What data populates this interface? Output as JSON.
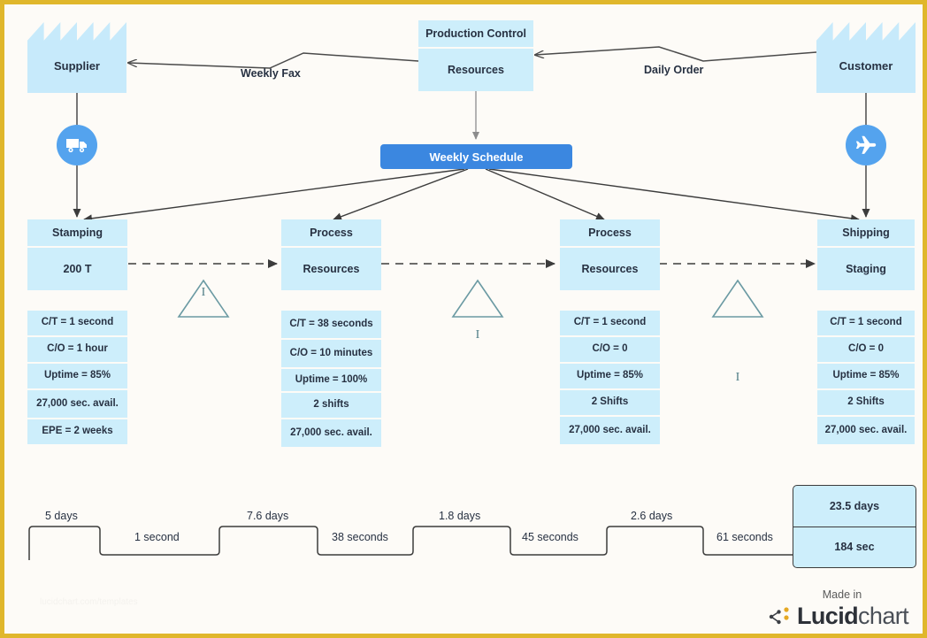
{
  "page": {
    "border_color": "#e0b72c",
    "background": "#fdfbf7",
    "watermark": "lucidchart.com/templates"
  },
  "colors": {
    "box_fill": "#cdeefb",
    "schedule_fill": "#3b87e0",
    "icon_circle": "#54a3ee",
    "triangle_stroke": "#4e7d86",
    "text": "#273142"
  },
  "entities": {
    "supplier": {
      "label": "Supplier",
      "icon": "factory-icon"
    },
    "customer": {
      "label": "Customer",
      "icon": "factory-icon"
    },
    "production_control": {
      "title": "Production Control",
      "body": "Resources"
    },
    "schedule": {
      "label": "Weekly Schedule"
    }
  },
  "transport": {
    "inbound": {
      "icon": "truck-icon"
    },
    "outbound": {
      "icon": "airplane-icon"
    }
  },
  "information_flows": [
    {
      "label": "Weekly Fax",
      "from": "production-control",
      "to": "supplier",
      "type": "electronic"
    },
    {
      "label": "Daily Order",
      "from": "customer",
      "to": "production-control",
      "type": "electronic"
    }
  ],
  "processes": [
    {
      "title": "Stamping",
      "body": "200 T",
      "metrics": [
        "C/T = 1 second",
        "C/O = 1 hour",
        "Uptime = 85%",
        "27,000 sec. avail.",
        "EPE = 2 weeks"
      ]
    },
    {
      "title": "Process",
      "body": "Resources",
      "metrics": [
        "C/T = 38 seconds",
        "C/O = 10 minutes",
        "Uptime = 100%",
        "2 shifts",
        "27,000 sec. avail."
      ]
    },
    {
      "title": "Process",
      "body": "Resources",
      "metrics": [
        "C/T = 1 second",
        "C/O = 0",
        "Uptime = 85%",
        "2 Shifts",
        "27,000 sec. avail."
      ]
    },
    {
      "title": "Shipping",
      "body": "Staging",
      "metrics": [
        "C/T = 1 second",
        "C/O = 0",
        "Uptime = 85%",
        "2 Shifts",
        "27,000 sec. avail."
      ]
    }
  ],
  "inventory_triangles": [
    {
      "symbol": "I"
    },
    {
      "symbol": "I"
    },
    {
      "symbol": "I"
    }
  ],
  "timeline": {
    "lead_times": [
      "5 days",
      "7.6 days",
      "1.8 days",
      "2.6 days"
    ],
    "process_times": [
      "1 second",
      "38 seconds",
      "45 seconds",
      "61 seconds"
    ],
    "totals": {
      "lead_time": "23.5 days",
      "process_time": "184 sec"
    }
  },
  "credit": {
    "made_in": "Made in",
    "brand_bold": "Lucid",
    "brand_light": "chart"
  }
}
